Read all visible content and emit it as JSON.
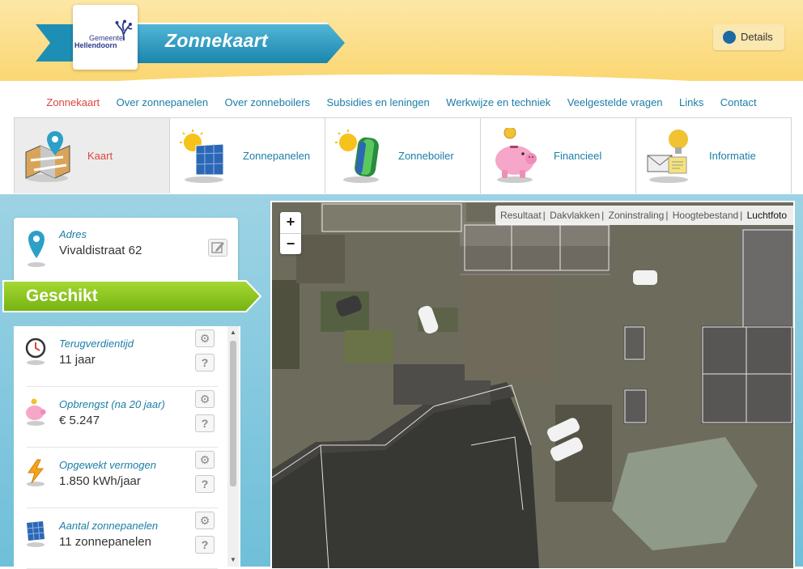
{
  "header": {
    "title": "Zonnekaart",
    "logo_line1": "Gemeente",
    "logo_line2": "Hellendoorn",
    "details_label": "Details"
  },
  "nav": {
    "items": [
      "Zonnekaart",
      "Over zonnepanelen",
      "Over zonneboilers",
      "Subsidies en leningen",
      "Werkwijze en techniek",
      "Veelgestelde vragen",
      "Links",
      "Contact"
    ],
    "active": "Zonnekaart"
  },
  "tabs": [
    {
      "label": "Kaart",
      "icon": "map-icon"
    },
    {
      "label": "Zonnepanelen",
      "icon": "solar-panel-icon"
    },
    {
      "label": "Zonneboiler",
      "icon": "solar-boiler-icon"
    },
    {
      "label": "Financieel",
      "icon": "piggy-bank-icon"
    },
    {
      "label": "Informatie",
      "icon": "information-icon"
    }
  ],
  "address": {
    "label": "Adres",
    "value": "Vivaldistraat 62"
  },
  "status": {
    "label": "Geschikt",
    "color": "#8cc518"
  },
  "stats": [
    {
      "label": "Terugverdientijd",
      "value": "11 jaar",
      "icon": "clock-icon"
    },
    {
      "label": "Opbrengst (na 20 jaar)",
      "value": "€ 5.247",
      "icon": "piggy-bank-icon"
    },
    {
      "label": "Opgewekt vermogen",
      "value": "1.850 kWh/jaar",
      "icon": "lightning-icon"
    },
    {
      "label": "Aantal zonnepanelen",
      "value": "11 zonnepanelen",
      "icon": "solar-panel-icon"
    }
  ],
  "map": {
    "layers": [
      "Resultaat",
      "Dakvlakken",
      "Zoninstraling",
      "Hoogtebestand",
      "Luchtfoto"
    ],
    "active_layer": "Luchtfoto",
    "zoom_in": "+",
    "zoom_out": "−"
  },
  "colors": {
    "accent": "#1b7ea6",
    "active": "#d9463d",
    "header": "#fbd772"
  }
}
